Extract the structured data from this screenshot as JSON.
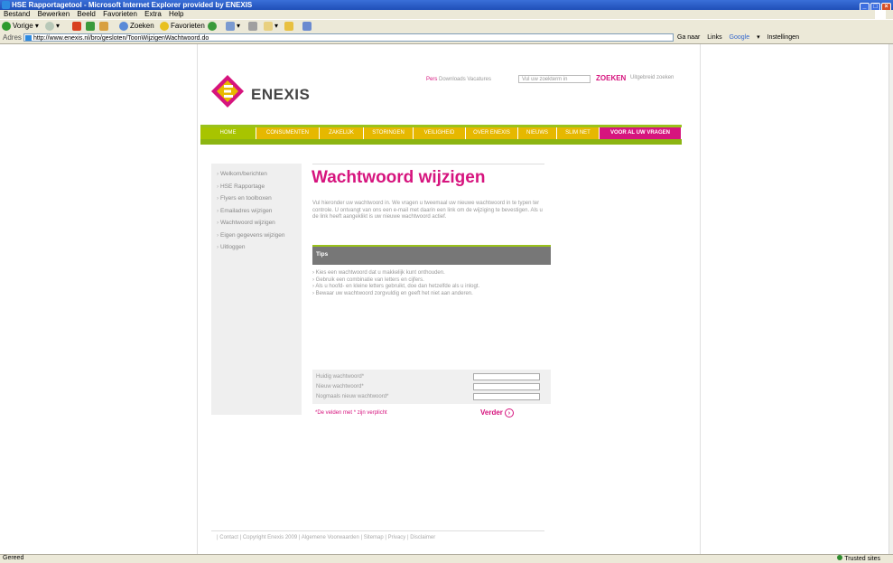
{
  "window": {
    "title": "HSE Rapportagetool - Microsoft Internet Explorer provided by ENEXIS"
  },
  "menubar": [
    "Bestand",
    "Bewerken",
    "Beeld",
    "Favorieten",
    "Extra",
    "Help"
  ],
  "toolbar": {
    "back": "Vorige",
    "search": "Zoeken",
    "favorites": "Favorieten"
  },
  "address": {
    "label": "Adres",
    "url": "http://www.enexis.nl/bro/gesloten/ToonWijzigenWachtwoord.do",
    "go": "Ga naar",
    "links": "Links",
    "google": "Google",
    "settings": "Instellingen"
  },
  "status": {
    "left": "Gereed",
    "zone": "Trusted sites"
  },
  "site": {
    "brand": "ENEXIS",
    "top_links": [
      "Pers",
      "Downloads",
      "Vacatures"
    ],
    "search_placeholder": "Vul uw zoekterm in",
    "search_button": "ZOEKEN",
    "advanced_search": "Uitgebreid zoeken",
    "nav": [
      "HOME",
      "CONSUMENTEN",
      "ZAKELIJK",
      "STORINGEN",
      "VEILIGHEID",
      "OVER ENEXIS",
      "NIEUWS",
      "SLIM NET",
      "VOOR AL UW VRAGEN"
    ],
    "sidebar": [
      "Welkom/berichten",
      "HSE Rapportage",
      "Flyers en toolboxen",
      "Emailadres wijzigen",
      "Wachtwoord wijzigen",
      "Eigen gegevens wijzigen",
      "Uitloggen"
    ],
    "page_title": "Wachtwoord wijzigen",
    "intro": "Vul hieronder uw wachtwoord in. We vragen u tweemaal uw nieuwe wachtwoord in te typen ter controle. U ontvangt van ons een e-mail met daarin een link om de wijziging te bevestigen. Als u de link heeft aangeklikt is uw nieuwe wachtwoord actief.",
    "tips_title": "Tips",
    "tips": [
      "Kies een wachtwoord dat u makkelijk kunt onthouden.",
      "Gebruik een combinatie van letters en cijfers.",
      "Als u hoofd- en kleine letters gebruikt, doe dan hetzelfde als u inlogt.",
      "Bewaar uw wachtwoord zorgvuldig en geeft het niet aan anderen."
    ],
    "form": {
      "current": "Huidig wachtwoord*",
      "new": "Nieuw wachtwoord*",
      "repeat": "Nogmaals nieuw wachtwoord*"
    },
    "required_note": "*De velden met * zijn verplicht",
    "submit": "Verder",
    "footer": [
      "Contact",
      "Copyright Enexis 2009",
      "Algemene Voorwaarden",
      "Sitemap",
      "Privacy",
      "Disclaimer"
    ]
  }
}
